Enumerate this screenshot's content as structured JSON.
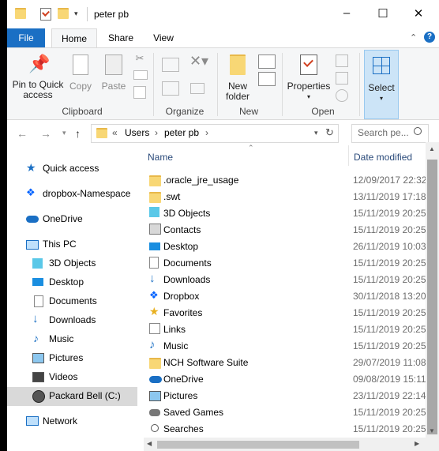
{
  "titlebar": {
    "title": "peter pb",
    "minimize": "–",
    "maximize": "☐",
    "close": "✕"
  },
  "tabs": {
    "file": "File",
    "home": "Home",
    "share": "Share",
    "view": "View"
  },
  "ribbon": {
    "pin_line1": "Pin to Quick",
    "pin_line2": "access",
    "copy": "Copy",
    "paste": "Paste",
    "new_folder_line1": "New",
    "new_folder_line2": "folder",
    "properties": "Properties",
    "select": "Select",
    "groups": {
      "clipboard": "Clipboard",
      "organize": "Organize",
      "new": "New",
      "open": "Open"
    }
  },
  "address": {
    "crumb_sep": "«",
    "crumb1": "Users",
    "crumb2": "peter pb",
    "search_placeholder": "Search pe..."
  },
  "nav_pane": {
    "quick_access": "Quick access",
    "dropbox": "dropbox-Namespace",
    "onedrive": "OneDrive",
    "this_pc": "This PC",
    "objects3d": "3D Objects",
    "desktop": "Desktop",
    "documents": "Documents",
    "downloads": "Downloads",
    "music": "Music",
    "pictures": "Pictures",
    "videos": "Videos",
    "drive": "Packard Bell (C:)",
    "network": "Network"
  },
  "columns": {
    "name": "Name",
    "date": "Date modified"
  },
  "files": [
    {
      "name": ".oracle_jre_usage",
      "date": "12/09/2017 22:32"
    },
    {
      "name": ".swt",
      "date": "13/11/2019 17:18"
    },
    {
      "name": "3D Objects",
      "date": "15/11/2019 20:25"
    },
    {
      "name": "Contacts",
      "date": "15/11/2019 20:25"
    },
    {
      "name": "Desktop",
      "date": "26/11/2019 10:03"
    },
    {
      "name": "Documents",
      "date": "15/11/2019 20:25"
    },
    {
      "name": "Downloads",
      "date": "15/11/2019 20:25"
    },
    {
      "name": "Dropbox",
      "date": "30/11/2018 13:20"
    },
    {
      "name": "Favorites",
      "date": "15/11/2019 20:25"
    },
    {
      "name": "Links",
      "date": "15/11/2019 20:25"
    },
    {
      "name": "Music",
      "date": "15/11/2019 20:25"
    },
    {
      "name": "NCH Software Suite",
      "date": "29/07/2019 11:08"
    },
    {
      "name": "OneDrive",
      "date": "09/08/2019 15:11"
    },
    {
      "name": "Pictures",
      "date": "23/11/2019 22:14"
    },
    {
      "name": "Saved Games",
      "date": "15/11/2019 20:25"
    },
    {
      "name": "Searches",
      "date": "15/11/2019 20:25"
    }
  ]
}
